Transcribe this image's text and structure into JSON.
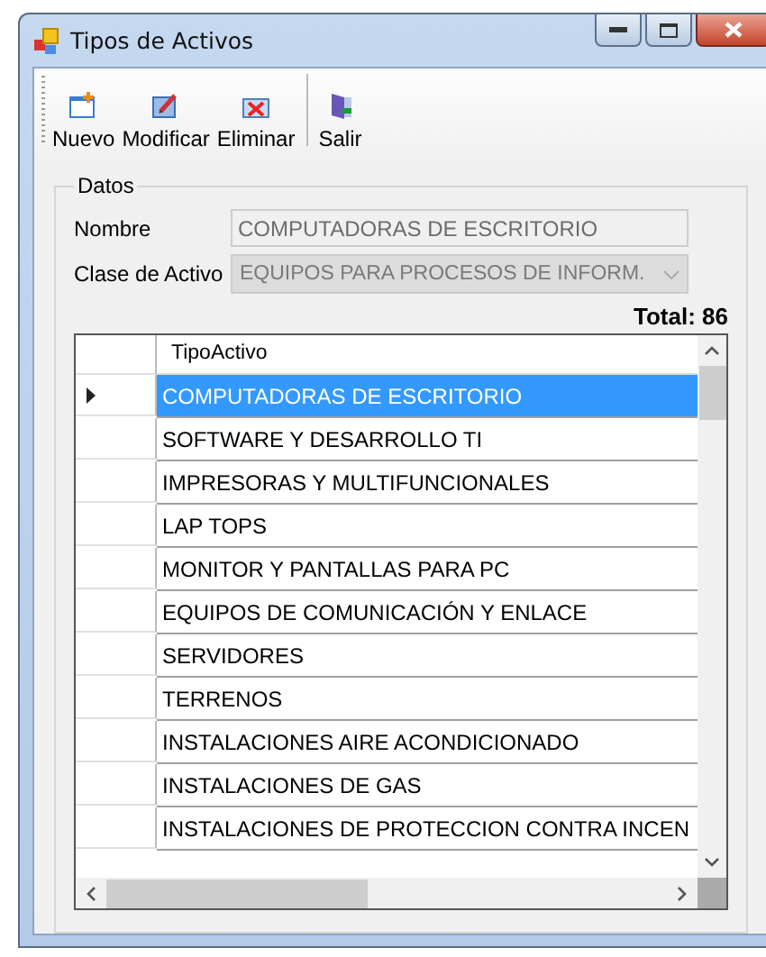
{
  "window": {
    "title": "Tipos de Activos"
  },
  "toolbar": [
    {
      "label": "Nuevo",
      "kind": "new"
    },
    {
      "label": "Modificar",
      "kind": "edit"
    },
    {
      "label": "Eliminar",
      "kind": "delete"
    },
    {
      "label": "Salir",
      "kind": "exit"
    }
  ],
  "group": {
    "title": "Datos",
    "nombre": {
      "label": "Nombre",
      "value": "COMPUTADORAS DE ESCRITORIO",
      "disabled": true
    },
    "clase": {
      "label": "Clase de Activo",
      "value": "EQUIPOS PARA PROCESOS DE INFORM.",
      "disabled": true
    },
    "total": "Total: 86"
  },
  "table": {
    "columns": [
      "TipoActivo"
    ],
    "rows": [
      {
        "cell": "COMPUTADORAS DE ESCRITORIO",
        "selected": true
      },
      {
        "cell": "SOFTWARE Y DESARROLLO TI",
        "selected": false
      },
      {
        "cell": "IMPRESORAS Y MULTIFUNCIONALES",
        "selected": false
      },
      {
        "cell": "LAP TOPS",
        "selected": false
      },
      {
        "cell": "MONITOR Y PANTALLAS PARA PC",
        "selected": false
      },
      {
        "cell": "EQUIPOS DE COMUNICACIÓN Y ENLACE",
        "selected": false
      },
      {
        "cell": "SERVIDORES",
        "selected": false
      },
      {
        "cell": "TERRENOS",
        "selected": false
      },
      {
        "cell": "INSTALACIONES AIRE ACONDICIONADO",
        "selected": false
      },
      {
        "cell": "INSTALACIONES DE GAS",
        "selected": false
      },
      {
        "cell": "INSTALACIONES DE PROTECCION CONTRA INCEN",
        "selected": false
      }
    ]
  }
}
